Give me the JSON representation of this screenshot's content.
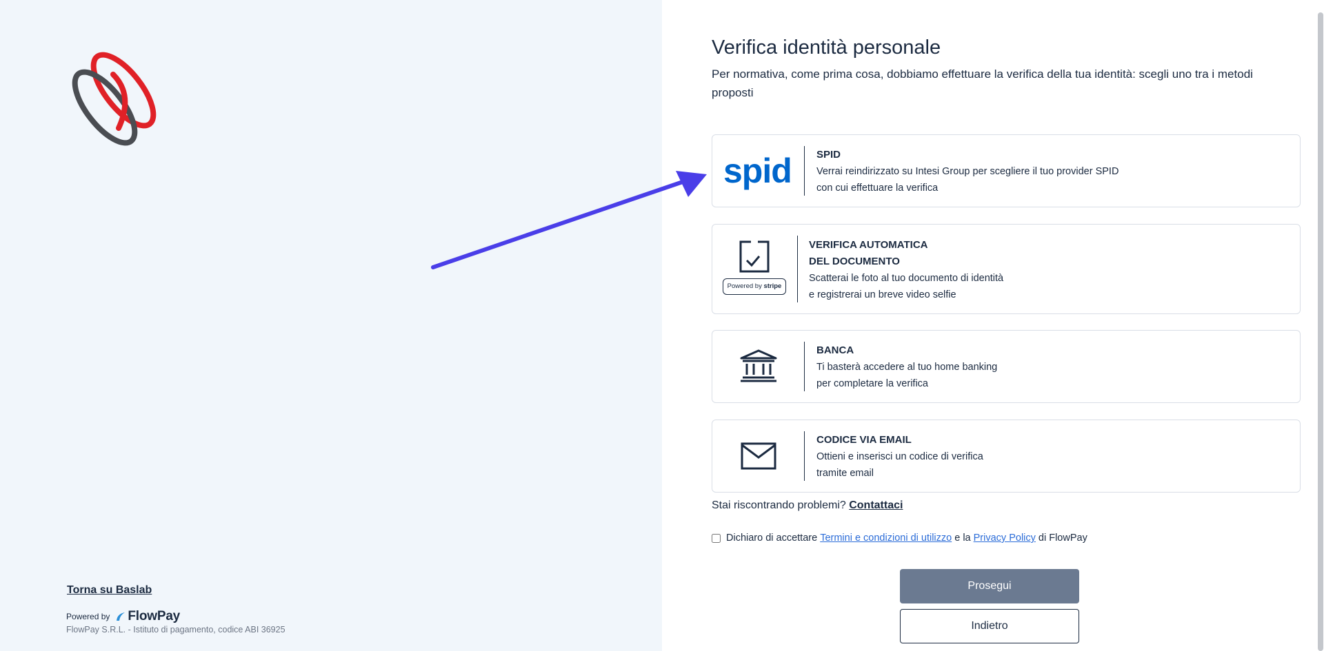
{
  "left": {
    "back_link": "Torna su Baslab",
    "powered_by": "Powered by",
    "brand": "FlowPay",
    "company": "FlowPay S.R.L. - Istituto di pagamento, codice ABI 36925"
  },
  "main": {
    "title": "Verifica identità personale",
    "subtitle": "Per normativa, come prima cosa, dobbiamo effettuare la verifica della tua identità: scegli uno tra i metodi proposti",
    "options": [
      {
        "logo_text": "spid",
        "heading": "SPID",
        "line1": "Verrai reindirizzato su Intesi Group per scegliere il tuo provider SPID",
        "line2": "con cui effettuare la verifica"
      },
      {
        "badge_prefix": "Powered by",
        "badge_brand": "stripe",
        "heading": "VERIFICA AUTOMATICA",
        "heading2": "DEL DOCUMENTO",
        "line1": "Scatterai le foto al tuo documento di identità",
        "line2": "e registrerai un breve video selfie"
      },
      {
        "heading": "BANCA",
        "line1": "Ti basterà accedere al tuo home banking",
        "line2": "per completare la verifica"
      },
      {
        "heading": "CODICE VIA EMAIL",
        "line1": "Ottieni e inserisci un codice di verifica",
        "line2": "tramite email"
      }
    ],
    "problems_text": "Stai riscontrando problemi?",
    "contact_link": "Contattaci",
    "terms": {
      "prefix": "Dichiaro di accettare ",
      "terms_link": "Termini e condizioni di utilizzo",
      "middle": " e la ",
      "privacy_link": "Privacy Policy",
      "suffix": " di FlowPay"
    },
    "primary_button": "Prosegui",
    "secondary_button": "Indietro"
  },
  "colors": {
    "left_bg": "#f1f6fb",
    "text": "#1b2a40",
    "spid_blue": "#0066cc",
    "link_blue": "#2b6cd8",
    "button_disabled": "#6b7a91",
    "arrow": "#4a3ee8",
    "logo_red": "#e02127",
    "logo_gray": "#4a4d52"
  },
  "icons": [
    "baslab-logo",
    "spid-logo",
    "document-check-icon",
    "bank-icon",
    "envelope-icon",
    "flowpay-logo",
    "annotation-arrow"
  ]
}
